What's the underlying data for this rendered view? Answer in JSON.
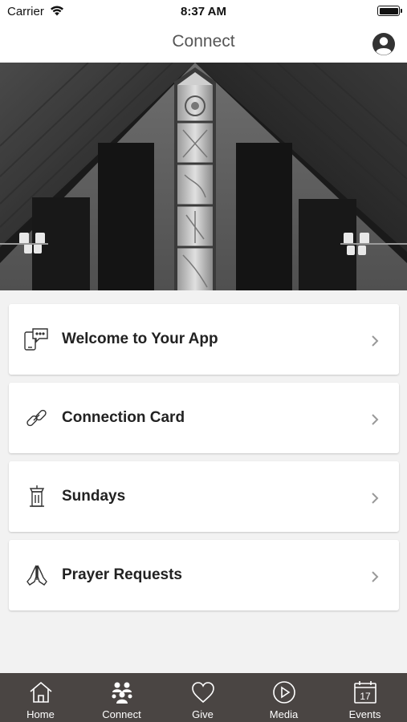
{
  "status_bar": {
    "carrier": "Carrier",
    "time": "8:37 AM"
  },
  "nav": {
    "title": "Connect"
  },
  "hero": {
    "description_icon": "church-stained-glass-photo"
  },
  "menu": {
    "items": [
      {
        "label": "Welcome to Your App",
        "icon": "phone-chat-icon"
      },
      {
        "label": "Connection Card",
        "icon": "link-icon"
      },
      {
        "label": "Sundays",
        "icon": "pulpit-icon"
      },
      {
        "label": "Prayer Requests",
        "icon": "praying-hands-icon"
      }
    ]
  },
  "tabs": [
    {
      "label": "Home",
      "icon": "home-icon"
    },
    {
      "label": "Connect",
      "icon": "people-icon"
    },
    {
      "label": "Give",
      "icon": "heart-icon"
    },
    {
      "label": "Media",
      "icon": "play-icon"
    },
    {
      "label": "Events",
      "icon": "calendar-icon",
      "day": "17"
    }
  ],
  "colors": {
    "tab_bar": "#4a4543",
    "card": "#ffffff",
    "background": "#f2f2f2"
  }
}
